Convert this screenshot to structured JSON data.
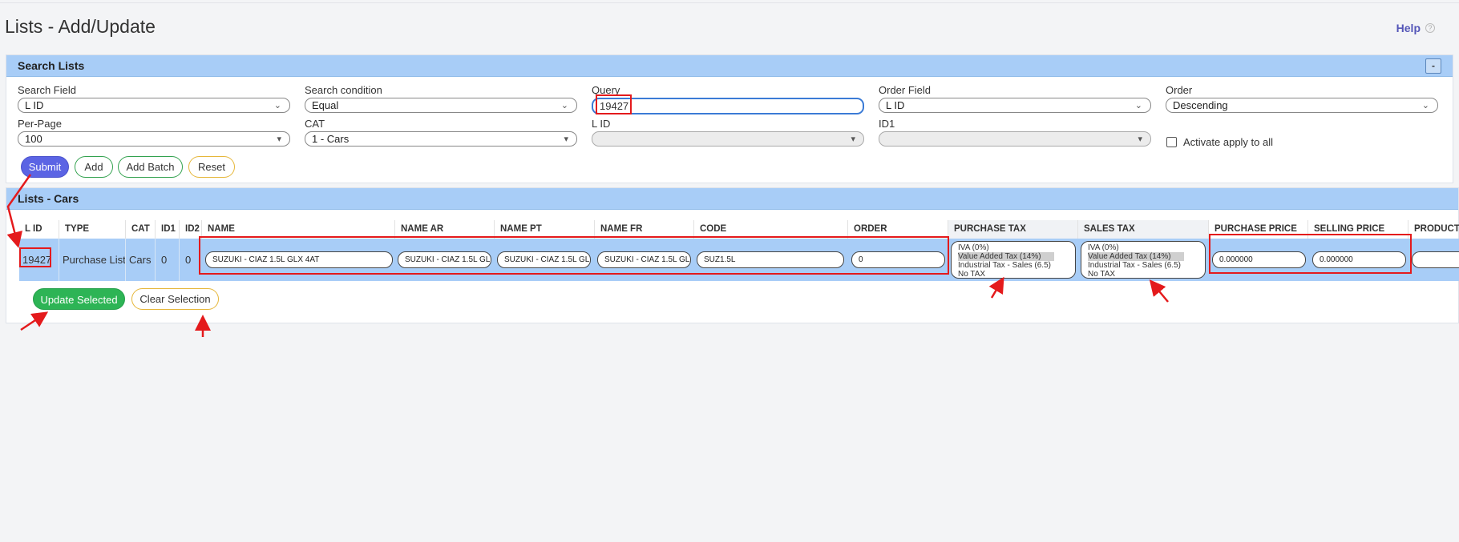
{
  "page": {
    "title": "Lists - Add/Update",
    "help_label": "Help",
    "help_icon": "question-circle-icon"
  },
  "search_panel": {
    "title": "Search Lists",
    "collapse_label": "-",
    "search_field": {
      "label": "Search Field",
      "value": "L ID"
    },
    "search_condition": {
      "label": "Search condition",
      "value": "Equal"
    },
    "query": {
      "label": "Query",
      "value": "19427"
    },
    "order_field": {
      "label": "Order Field",
      "value": "L ID"
    },
    "order": {
      "label": "Order",
      "value": "Descending"
    },
    "per_page": {
      "label": "Per-Page",
      "value": "100"
    },
    "cat": {
      "label": "CAT",
      "value": "1 - Cars"
    },
    "lid": {
      "label": "L ID",
      "value": ""
    },
    "id1": {
      "label": "ID1",
      "value": ""
    },
    "apply_all_label": "Activate apply to all",
    "buttons": {
      "submit": "Submit",
      "add": "Add",
      "add_batch": "Add Batch",
      "reset": "Reset"
    }
  },
  "list_panel": {
    "title": "Lists - Cars",
    "columns": [
      "L ID",
      "TYPE",
      "CAT",
      "ID1",
      "ID2",
      "NAME",
      "NAME AR",
      "NAME PT",
      "NAME FR",
      "CODE",
      "ORDER",
      "PURCHASE TAX",
      "SALES TAX",
      "PURCHASE PRICE",
      "SELLING PRICE",
      "PRODUCT"
    ],
    "row": {
      "lid": "19427",
      "type": "Purchase List",
      "cat": "Cars",
      "id1": "0",
      "id2": "0",
      "name": "SUZUKI - CIAZ 1.5L GLX 4AT",
      "name_ar": "SUZUKI - CIAZ 1.5L GL",
      "name_pt": "SUZUKI - CIAZ 1.5L GL",
      "name_fr": "SUZUKI - CIAZ 1.5L GL",
      "code": "SUZ1.5L",
      "order": "0",
      "purchase_tax": {
        "options": [
          "IVA (0%)",
          "Value Added Tax (14%)",
          "Industrial Tax - Sales (6.5)",
          "No TAX"
        ],
        "selected": "Value Added Tax (14%)"
      },
      "sales_tax": {
        "options": [
          "IVA (0%)",
          "Value Added Tax (14%)",
          "Industrial Tax - Sales (6.5)",
          "No TAX"
        ],
        "selected": "Value Added Tax (14%)"
      },
      "purchase_price": "0.000000",
      "selling_price": "0.000000",
      "product": ""
    },
    "buttons": {
      "update_selected": "Update Selected",
      "clear_selection": "Clear Selection"
    }
  },
  "colors": {
    "accent": "#5b64e4",
    "panel_header": "#a8cdf7",
    "success": "#2db455",
    "annotation": "#e41a1c"
  }
}
